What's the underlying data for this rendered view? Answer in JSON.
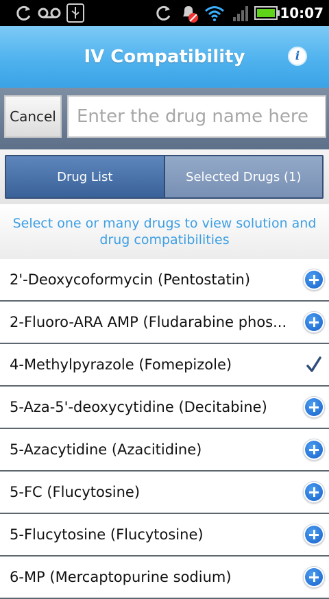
{
  "status_bar": {
    "time": "10:07",
    "icons": [
      "sync-icon",
      "voicemail-icon",
      "usb-icon",
      "sync-icon",
      "alarm-off-icon",
      "wifi-icon",
      "signal-icon",
      "battery-icon"
    ]
  },
  "header": {
    "title": "IV Compatibility",
    "info_icon": "info-icon",
    "info_label": "i"
  },
  "search": {
    "cancel_label": "Cancel",
    "placeholder": "Enter the drug name here",
    "value": ""
  },
  "tabs": [
    {
      "label": "Drug List",
      "selected": true
    },
    {
      "label": "Selected Drugs (1)",
      "selected": false
    }
  ],
  "instructions": "Select one or many drugs to view solution and drug compatibilities",
  "drugs": [
    {
      "label": "2'-Deoxycoformycin (Pentostatin)",
      "selected": false
    },
    {
      "label": "2-Fluoro-ARA AMP (Fludarabine phos...",
      "selected": false
    },
    {
      "label": "4-Methylpyrazole (Fomepizole)",
      "selected": true
    },
    {
      "label": "5-Aza-5'-deoxycytidine (Decitabine)",
      "selected": false
    },
    {
      "label": "5-Azacytidine (Azacitidine)",
      "selected": false
    },
    {
      "label": "5-FC (Flucytosine)",
      "selected": false
    },
    {
      "label": "5-Flucytosine (Flucytosine)",
      "selected": false
    },
    {
      "label": "6-MP (Mercaptopurine sodium)",
      "selected": false
    }
  ],
  "colors": {
    "header_blue": "#4fb2ee",
    "tab_active": "#3a6299",
    "instruction_text": "#3d9ee3",
    "add_icon": "#1560c9"
  }
}
